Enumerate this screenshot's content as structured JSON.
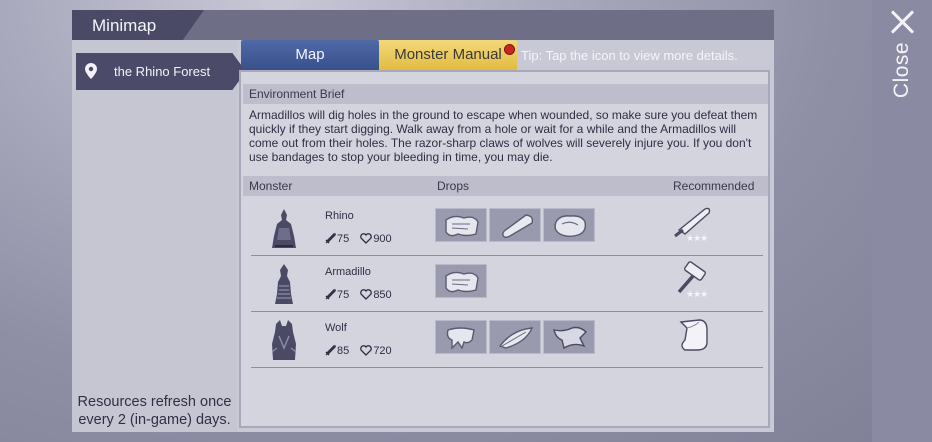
{
  "panel": {
    "title": "Minimap"
  },
  "close": {
    "label": "Close"
  },
  "left": {
    "region": "the Rhino Forest",
    "refresh_note": "Resources refresh once every 2 (in-game) days."
  },
  "tabs": {
    "map": "Map",
    "manual": "Monster Manual",
    "tip": "Tip: Tap the icon to view more details."
  },
  "brief": {
    "heading": "Environment Brief",
    "text": "Armadillos will dig holes in the ground to escape when wounded, so make sure you defeat them quickly if they start digging. Walk away from a hole or wait for a while and the Armadillos will come out from their holes. The razor-sharp claws of wolves will severely injure you. If you don't use bandages to stop your bleeding in time, you may die."
  },
  "table": {
    "col_monster": "Monster",
    "col_drops": "Drops",
    "col_recommended": "Recommended",
    "rows": [
      {
        "name": "Rhino",
        "attack": "75",
        "health": "900",
        "drops": [
          "hide-icon",
          "bone-club-icon",
          "raw-meat-icon"
        ],
        "recommended": "machete-icon",
        "stars": "★★★"
      },
      {
        "name": "Armadillo",
        "attack": "75",
        "health": "850",
        "drops": [
          "hide-icon"
        ],
        "recommended": "hammer-icon",
        "stars": "★★★"
      },
      {
        "name": "Wolf",
        "attack": "85",
        "health": "720",
        "drops": [
          "claw-icon",
          "feather-icon",
          "pelt-icon"
        ],
        "recommended": "bandage-icon",
        "stars": ""
      }
    ]
  },
  "colors": {
    "tab_map": "#39508a",
    "tab_manual": "#e1ba3c",
    "notification": "#c9261f",
    "region_active": "#4b4b69"
  }
}
